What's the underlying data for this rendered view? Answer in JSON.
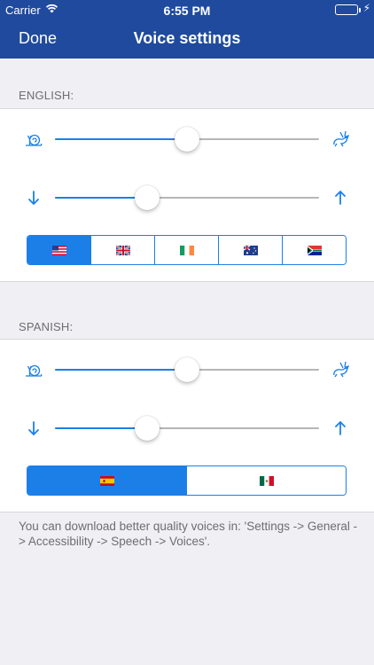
{
  "status_bar": {
    "carrier": "Carrier",
    "time": "6:55 PM",
    "battery_level": 1.0,
    "wifi_icon": "wifi-icon",
    "battery_icon": "battery-icon",
    "charging_icon": "bolt-icon"
  },
  "nav": {
    "done_label": "Done",
    "title": "Voice settings",
    "background": "#1f4a9e"
  },
  "accent": "#1c7fe8",
  "sections": {
    "english": {
      "header": "ENGLISH:",
      "speed": {
        "left_icon": "snail-icon",
        "right_icon": "rabbit-icon",
        "value": 0.5
      },
      "pitch": {
        "left_icon": "arrow-down-icon",
        "right_icon": "arrow-up-icon",
        "value": 0.35
      },
      "accents": [
        {
          "flag": "us-flag-icon",
          "selected": true
        },
        {
          "flag": "uk-flag-icon",
          "selected": false
        },
        {
          "flag": "ireland-flag-icon",
          "selected": false
        },
        {
          "flag": "australia-flag-icon",
          "selected": false
        },
        {
          "flag": "south-africa-flag-icon",
          "selected": false
        }
      ]
    },
    "spanish": {
      "header": "SPANISH:",
      "speed": {
        "left_icon": "snail-icon",
        "right_icon": "rabbit-icon",
        "value": 0.5
      },
      "pitch": {
        "left_icon": "arrow-down-icon",
        "right_icon": "arrow-up-icon",
        "value": 0.35
      },
      "accents": [
        {
          "flag": "spain-flag-icon",
          "selected": true
        },
        {
          "flag": "mexico-flag-icon",
          "selected": false
        }
      ]
    }
  },
  "footer_note": "You can download better quality voices in: 'Settings -> General -> Accessibility -> Speech -> Voices'."
}
